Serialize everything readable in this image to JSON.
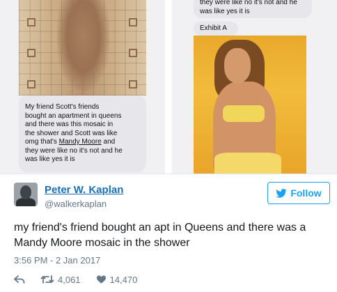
{
  "media": {
    "left_message": {
      "line1": "My friend Scott's friends",
      "line2": "bought an apartment in queens",
      "line3": "and there was this mosaic in",
      "line4": "the shower and Scott was like",
      "line5_pre": "omg that's ",
      "line5_link": "Mandy Moore",
      "line5_post": " and",
      "line6": "they were like no it's not and he",
      "line7": "was like yes it is"
    },
    "right_message": {
      "line1": "they were like no it's not and he",
      "line2": "was like yes it is"
    },
    "exhibit_label": "Exhibit A"
  },
  "tweet": {
    "author_name": "Peter W. Kaplan",
    "author_handle": "@walkerkaplan",
    "follow_label": "Follow",
    "text": "my friend's friend bought an apt in Queens and there was a Mandy Moore mosaic in the shower",
    "timestamp": "3:56 PM - 2 Jan 2017",
    "retweets": "4,061",
    "likes": "14,470"
  },
  "icons": {
    "follow": "twitter-bird-icon",
    "reply": "reply-icon",
    "retweet": "retweet-icon",
    "like": "heart-icon"
  },
  "colors": {
    "accent": "#1da1f2",
    "name_link": "#1b6fb5",
    "muted": "#657786",
    "bubble": "#e6e6eb"
  }
}
